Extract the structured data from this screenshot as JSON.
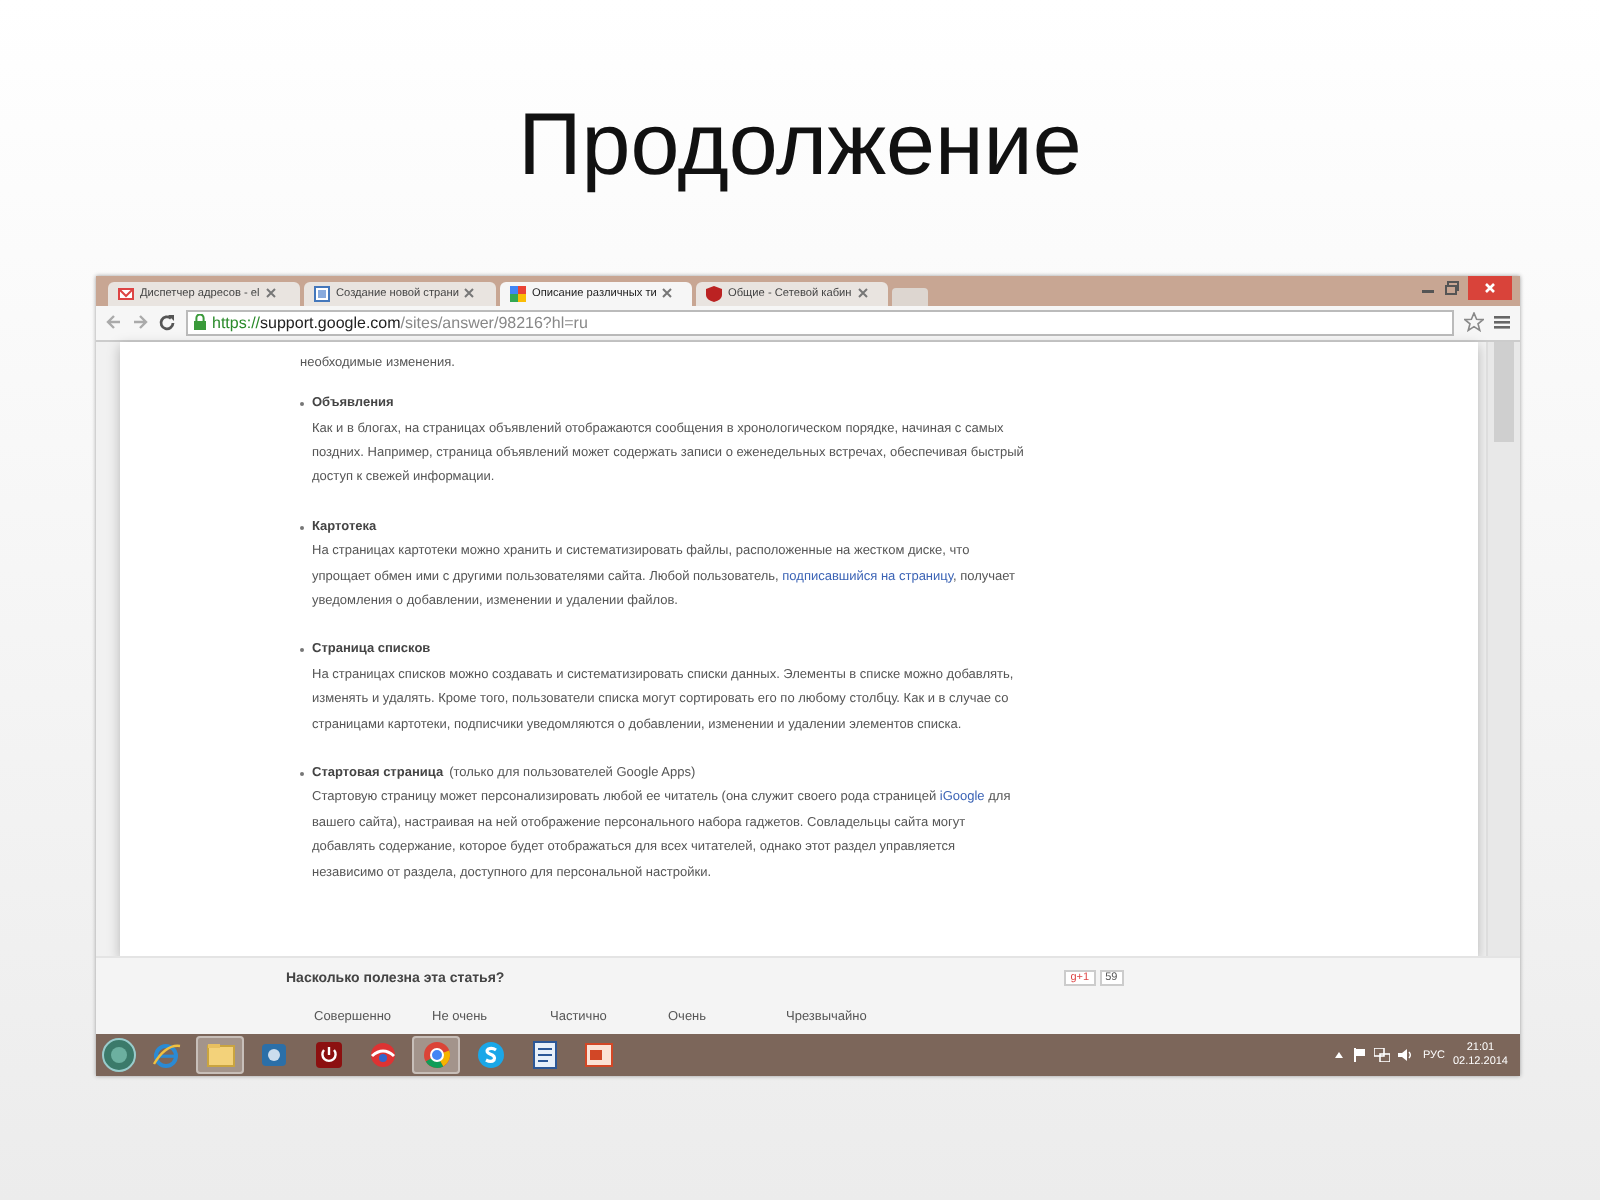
{
  "slide": {
    "title": "Продолжение"
  },
  "browser": {
    "tabs": [
      {
        "label": "Диспетчер адресов - el",
        "selected": false,
        "kind": "mail"
      },
      {
        "label": "Создание новой страни",
        "selected": false,
        "kind": "page"
      },
      {
        "label": "Описание различных ти",
        "selected": true,
        "kind": "grid"
      },
      {
        "label": "Общие - Сетевой кабин",
        "selected": false,
        "kind": "shield"
      }
    ],
    "url": {
      "scheme": "https://",
      "host": "support.google.com",
      "path": "/sites/answer/98216?hl=ru"
    },
    "article": {
      "intro": "необходимые изменения.",
      "items": [
        {
          "title": "Объявления",
          "segments": [
            {
              "kind": "text",
              "text": "Как и в блогах, на страницах объявлений отображаются сообщения в хронологическом порядке, начиная с самых поздних. Например, страница объявлений может содержать записи о еженедельных встречах, обеспечивая быстрый доступ к свежей информации."
            }
          ]
        },
        {
          "title": "Картотека",
          "segments": [
            {
              "kind": "text",
              "text": "На страницах картотеки можно хранить и систематизировать файлы, расположенные на жестком диске, что упрощает обмен ими с другими пользователями сайта. Любой пользователь, "
            },
            {
              "kind": "link",
              "text": "подписавшийся на страницу"
            },
            {
              "kind": "text",
              "text": ", получает уведомления о добавлении, изменении и удалении файлов."
            }
          ]
        },
        {
          "title": "Страница списков",
          "segments": [
            {
              "kind": "text",
              "text": "На страницах списков можно создавать и систематизировать списки данных. Элементы в списке можно добавлять, изменять и удалять. Кроме того, пользователи списка могут сортировать его по любому столбцу. Как и в случае со страницами картотеки, подписчики уведомляются о добавлении, изменении и удалении элементов списка."
            }
          ]
        },
        {
          "title": "Стартовая страница",
          "note": "(только для пользователей Google Apps)",
          "segments": [
            {
              "kind": "text",
              "text": "Стартовую страницу может персонализировать любой ее читатель (она служит своего рода страницей "
            },
            {
              "kind": "link",
              "text": "iGoogle"
            },
            {
              "kind": "text",
              "text": " для вашего сайта), настраивая на ней отображение персонального набора гаджетов. Совладельцы сайта могут добавлять содержание, которое будет отображаться для всех читателей, однако этот раздел управляется независимо от раздела, доступного для персональной настройки."
            }
          ]
        }
      ]
    },
    "feedback": {
      "question": "Насколько полезна эта статья?",
      "plus_label": "g+1",
      "plus_count": "59",
      "ratings": [
        "Совершенно",
        "Не очень",
        "Частично",
        "Очень",
        "Чрезвычайно"
      ]
    }
  },
  "taskbar": {
    "apps": [
      {
        "kind": "ie",
        "active": false
      },
      {
        "kind": "folder",
        "active": true
      },
      {
        "kind": "camera",
        "active": false
      },
      {
        "kind": "power",
        "active": false
      },
      {
        "kind": "ball",
        "active": false
      },
      {
        "kind": "chrome",
        "active": true
      },
      {
        "kind": "skype",
        "active": false
      },
      {
        "kind": "word",
        "active": false
      },
      {
        "kind": "slides",
        "active": false
      }
    ],
    "language": "РУС",
    "time": "21:01",
    "date": "02.12.2014"
  }
}
